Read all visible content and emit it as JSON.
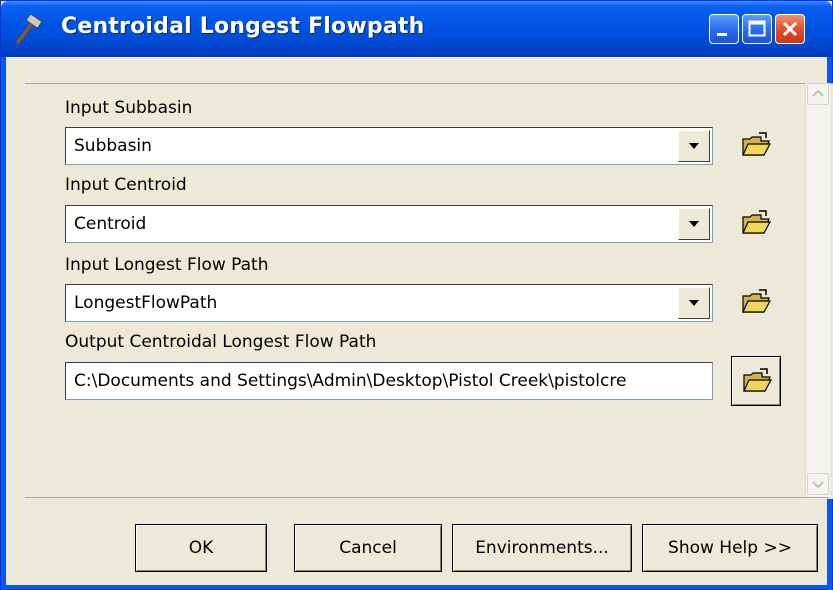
{
  "window": {
    "title": "Centroidal Longest Flowpath"
  },
  "form": {
    "fields": [
      {
        "label": "Input Subbasin",
        "value": "Subbasin",
        "control": "dropdown"
      },
      {
        "label": "Input Centroid",
        "value": "Centroid",
        "control": "dropdown"
      },
      {
        "label": "Input Longest Flow Path",
        "value": "LongestFlowPath",
        "control": "dropdown"
      },
      {
        "label": "Output Centroidal Longest Flow Path",
        "value": "C:\\Documents and Settings\\Admin\\Desktop\\Pistol Creek\\pistolcre",
        "control": "text"
      }
    ]
  },
  "buttons": {
    "ok": "OK",
    "cancel": "Cancel",
    "environments": "Environments...",
    "help": "Show Help >>"
  },
  "icons": {
    "title": "hammer-icon",
    "browse": "open-folder-icon",
    "dropdown": "chevron-down-icon"
  },
  "colors": {
    "titlebar": "#0054e3",
    "dialog": "#ece9d8",
    "close": "#e05030"
  }
}
